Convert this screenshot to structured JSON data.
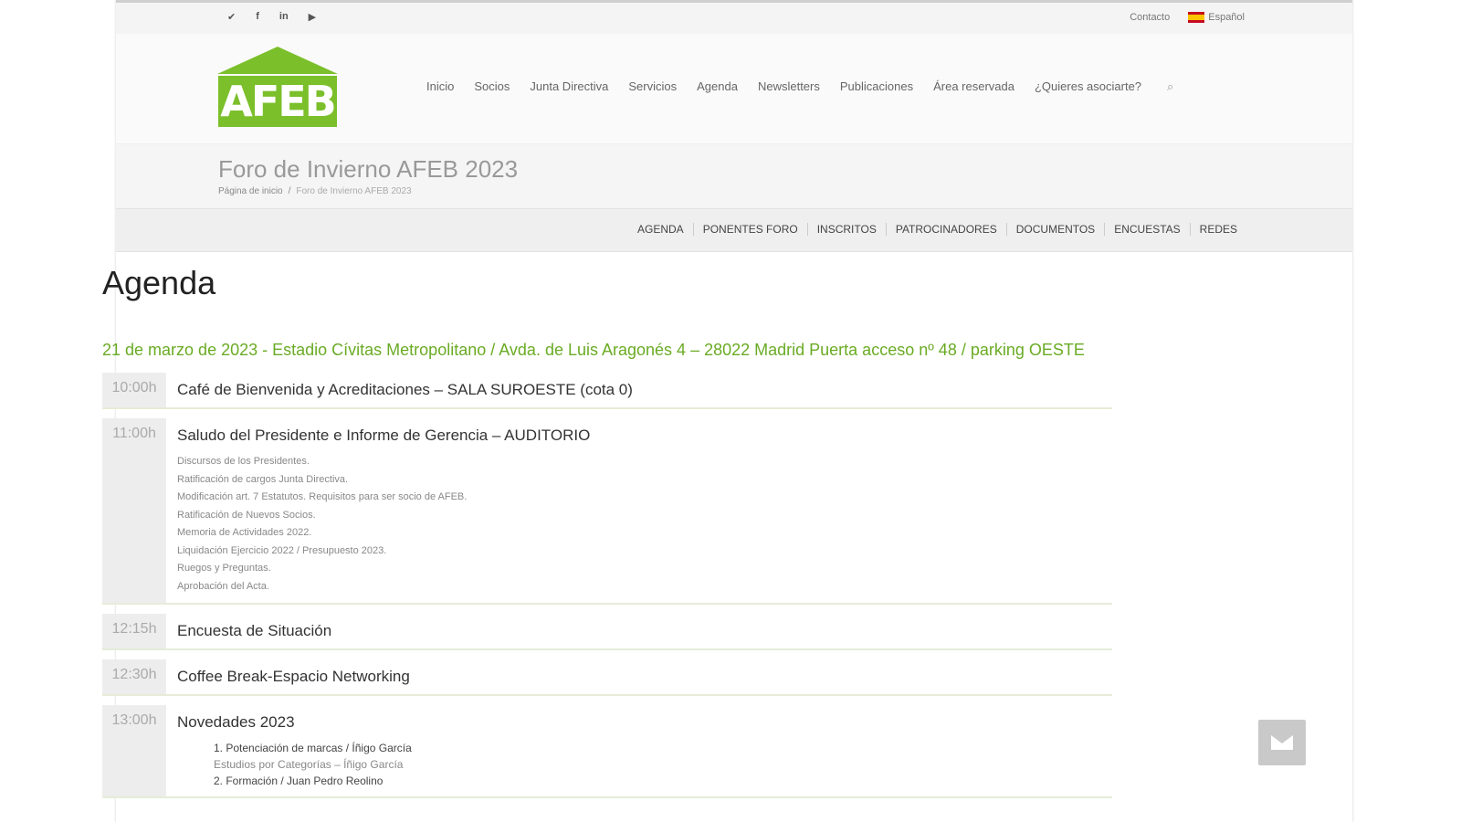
{
  "topbar": {
    "social_icons": [
      "twitter-icon",
      "facebook-icon",
      "linkedin-icon",
      "youtube-icon"
    ],
    "social_glyphs": [
      "✔",
      "f",
      "in",
      "▶"
    ],
    "contact": "Contacto",
    "language": "Español"
  },
  "logo": {
    "text": "AFEB",
    "color": "#7bbf2a"
  },
  "nav": {
    "items": [
      "Inicio",
      "Socios",
      "Junta Directiva",
      "Servicios",
      "Agenda",
      "Newsletters",
      "Publicaciones",
      "Área reservada",
      "¿Quieres asociarte?"
    ],
    "search_glyph": "⌕"
  },
  "page": {
    "title": "Foro de Invierno AFEB 2023",
    "breadcrumb": [
      "Página de inicio",
      "Foro de Invierno AFEB 2023"
    ]
  },
  "subnav": [
    "AGENDA",
    "PONENTES FORO",
    "INSCRITOS",
    "PATROCINADORES",
    "DOCUMENTOS",
    "ENCUESTAS",
    "REDES"
  ],
  "agenda": {
    "heading": "Agenda",
    "date_line": "21 de marzo de 2023 - Estadio Cívitas Metropolitano / Avda. de Luis Aragonés 4 – 28022 Madrid Puerta acceso nº 48 / parking OESTE",
    "items": [
      {
        "time": "10:00h",
        "title": "Café de Bienvenida y Acreditaciones – SALA SUROESTE (cota 0)"
      },
      {
        "time": "11:00h",
        "title": "Saludo del Presidente e Informe de Gerencia – AUDITORIO",
        "details": [
          "Discursos de los Presidentes.",
          "Ratificación de cargos Junta Directiva.",
          "Modificación art. 7 Estatutos. Requisitos para ser socio de AFEB.",
          "Ratificación de Nuevos Socios.",
          "Memoria de Actividades 2022.",
          "Liquidación Ejercicio 2022 / Presupuesto 2023.",
          "Ruegos y Preguntas.",
          "Aprobación del Acta."
        ]
      },
      {
        "time": "12:15h",
        "title": "Encuesta de Situación"
      },
      {
        "time": "12:30h",
        "title": "Coffee Break-Espacio Networking"
      },
      {
        "time": "13:00h",
        "title": "Novedades 2023",
        "sub": [
          {
            "label": "1. Potenciación de marcas / Íñigo García",
            "note": "Estudios por Categorías – Íñigo García"
          },
          {
            "label": "2. Formación / Juan Pedro Reolino",
            "note": ""
          }
        ]
      }
    ]
  },
  "contact_button": {
    "icon": "envelope-icon"
  }
}
